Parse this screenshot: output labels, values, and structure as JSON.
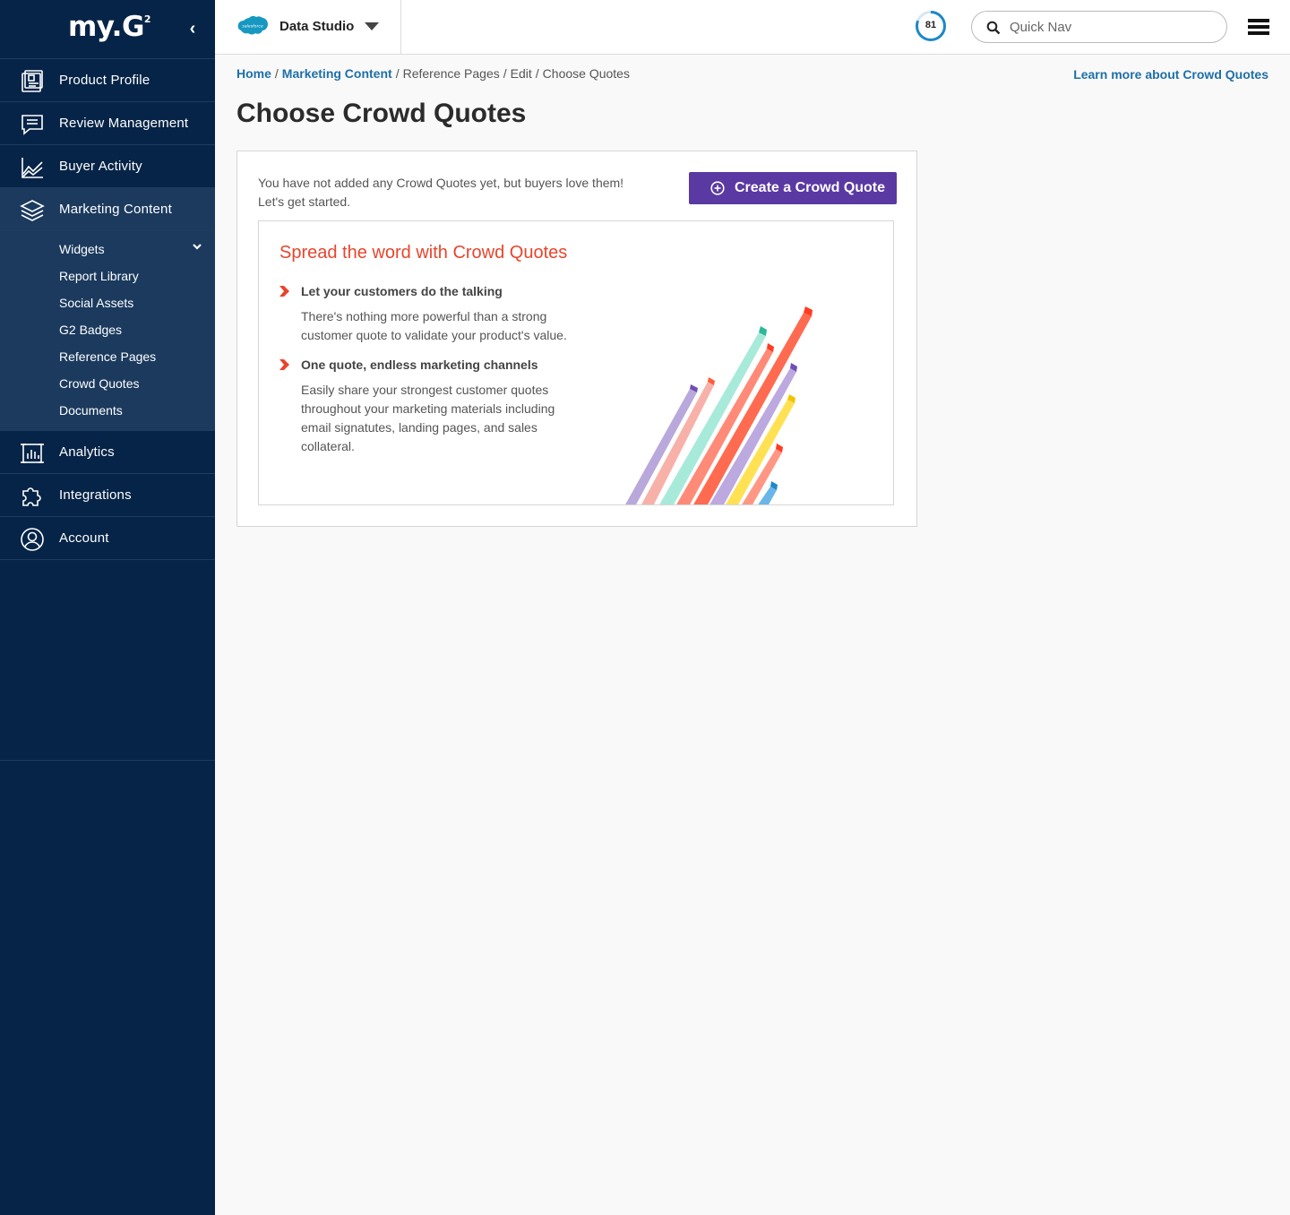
{
  "sidebar": {
    "logo": "my.G",
    "logo_sup": "2",
    "collapse": "‹",
    "items": [
      {
        "label": "Product Profile",
        "icon": "product-profile-icon"
      },
      {
        "label": "Review Management",
        "icon": "chat-icon"
      },
      {
        "label": "Buyer Activity",
        "icon": "line-chart-icon"
      },
      {
        "label": "Marketing Content",
        "icon": "layers-icon"
      },
      {
        "label": "Analytics",
        "icon": "bar-chart-icon"
      },
      {
        "label": "Integrations",
        "icon": "puzzle-icon"
      },
      {
        "label": "Account",
        "icon": "user-circle-icon"
      }
    ],
    "subitems": [
      "Widgets",
      "Report Library",
      "Social Assets",
      "G2 Badges",
      "Reference Pages",
      "Crowd Quotes",
      "Documents"
    ]
  },
  "topbar": {
    "product_name": "Data Studio",
    "product_logo_text": "salesforce",
    "score": "81",
    "search_placeholder": "Quick Nav"
  },
  "breadcrumb": {
    "home": "Home",
    "marketing": "Marketing Content",
    "reference": "Reference Pages",
    "edit": "Edit",
    "current": "Choose Quotes",
    "sep": "/"
  },
  "learn_more": "Learn more about Crowd Quotes",
  "page_title": "Choose Crowd Quotes",
  "card": {
    "empty_message": "You have not added any Crowd Quotes yet, but buyers love them! Let's get started.",
    "create_button": "Create a Crowd Quote",
    "promo_title": "Spread the word with Crowd Quotes",
    "features": [
      {
        "title": "Let your customers do the talking",
        "body": "There's nothing more powerful than a strong customer quote to validate your product's value."
      },
      {
        "title": "One quote, endless marketing channels",
        "body": "Easily share your strongest customer quotes throughout your marketing materials including email signatutes, landing pages, and sales collateral."
      }
    ]
  },
  "colors": {
    "sidebar_bg": "#062447",
    "sidebar_active": "#1b3a5e",
    "link": "#1e6fa8",
    "button": "#5a39a2",
    "promo": "#e8452c"
  }
}
